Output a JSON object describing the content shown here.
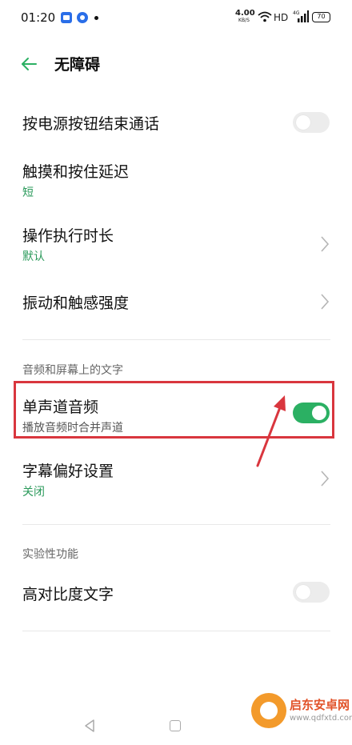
{
  "status_bar": {
    "time": "01:20",
    "net_speed": "4.00",
    "net_unit": "KB/S",
    "hd": "HD",
    "battery": "70"
  },
  "header": {
    "title": "无障碍",
    "back_icon": "arrow-left-icon"
  },
  "settings": {
    "end_call_power": {
      "title": "按电源按钮结束通话",
      "enabled": false
    },
    "touch_hold_delay": {
      "title": "触摸和按住延迟",
      "value": "短"
    },
    "action_duration": {
      "title": "操作执行时长",
      "value": "默认"
    },
    "vibration": {
      "title": "振动和触感强度"
    },
    "section_audio": "音频和屏幕上的文字",
    "mono_audio": {
      "title": "单声道音频",
      "subtitle": "播放音频时合并声道",
      "enabled": true
    },
    "caption_prefs": {
      "title": "字幕偏好设置",
      "value": "关闭"
    },
    "section_experimental": "实验性功能",
    "high_contrast_text": {
      "title": "高对比度文字",
      "enabled": false
    }
  },
  "colors": {
    "accent": "#2bb063",
    "value_text": "#2b9a5b",
    "annotation": "#d9363e"
  },
  "watermark": {
    "name": "启东安卓网",
    "url": "www.qdfxtd.com"
  }
}
